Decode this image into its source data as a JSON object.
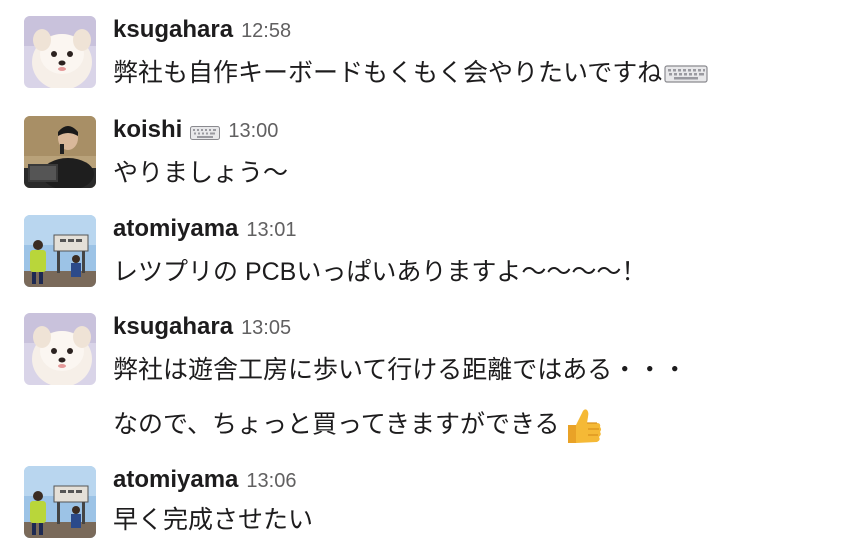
{
  "messages": [
    {
      "user": "ksugahara",
      "time": "12:58",
      "lines": [
        "弊社も自作キーボードもくもく会やりたいですね"
      ],
      "trailing_emoji": "keyboard-emoji",
      "avatar": "dog-avatar"
    },
    {
      "user": "koishi",
      "status_emoji": "keyboard-emoji",
      "time": "13:00",
      "lines": [
        "やりましょう〜"
      ],
      "avatar": "speaker-avatar"
    },
    {
      "user": "atomiyama",
      "time": "13:01",
      "lines": [
        "レツプリの PCBいっぱいありますよ〜〜〜〜！"
      ],
      "avatar": "runner-avatar"
    },
    {
      "user": "ksugahara",
      "time": "13:05",
      "lines": [
        "弊社は遊舎工房に歩いて行ける距離ではある・・・",
        "なので、ちょっと買ってきますができる"
      ],
      "trailing_emoji": "thumbs-up-emoji",
      "avatar": "dog-avatar"
    },
    {
      "user": "atomiyama",
      "time": "13:06",
      "lines": [
        "早く完成させたい"
      ],
      "avatar": "runner-avatar"
    }
  ],
  "colors": {
    "text": "#1d1c1d",
    "timestamp": "#616061",
    "thumbs_up": "#f5b936"
  }
}
